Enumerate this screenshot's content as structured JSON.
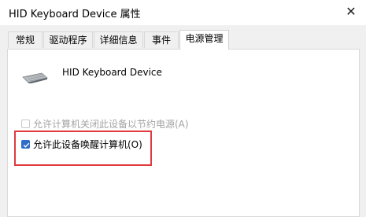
{
  "window": {
    "title": "HID Keyboard Device 属性",
    "close_icon": "close-icon",
    "close_glyph": "✕"
  },
  "tabs": [
    {
      "label": "常规"
    },
    {
      "label": "驱动程序"
    },
    {
      "label": "详细信息"
    },
    {
      "label": "事件"
    },
    {
      "label": "电源管理",
      "active": true
    }
  ],
  "device": {
    "icon": "keyboard-icon",
    "name": "HID Keyboard Device"
  },
  "options": {
    "allow_turn_off": {
      "label": "允许计算机关闭此设备以节约电源(A)",
      "checked": false,
      "enabled": false
    },
    "allow_wake": {
      "label": "允许此设备唤醒计算机(O)",
      "checked": true,
      "enabled": true
    }
  },
  "colors": {
    "highlight": "#e0393e",
    "checkbox_accent": "#2f6dc8"
  }
}
